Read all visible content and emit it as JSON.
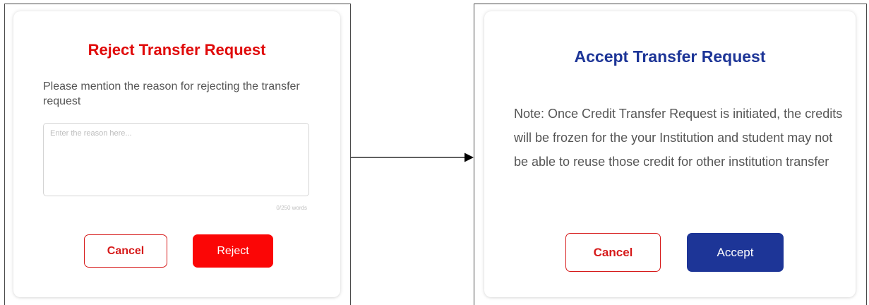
{
  "reject_dialog": {
    "title": "Reject Transfer Request",
    "prompt": "Please mention the reason for rejecting the transfer request",
    "input_placeholder": "Enter the reason here...",
    "word_count": "0/250 words",
    "cancel_label": "Cancel",
    "reject_label": "Reject"
  },
  "accept_dialog": {
    "title": "Accept Transfer Request",
    "note": "Note: Once Credit Transfer Request is initiated, the credits will be frozen for the your Institution and student may not be able to reuse those credit for other institution transfer",
    "cancel_label": "Cancel",
    "accept_label": "Accept"
  },
  "colors": {
    "reject_red": "#fb0606",
    "accept_blue": "#1d3597",
    "cancel_border": "#d61a1a"
  }
}
